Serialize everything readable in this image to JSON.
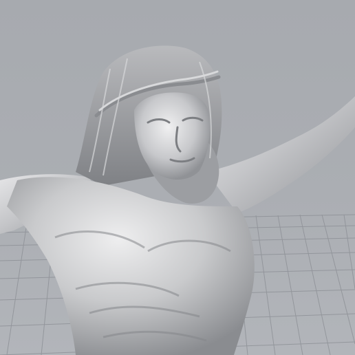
{
  "viewport": {
    "background_color": "#a9acb1",
    "grid_color": "#8e9197",
    "model_color": "#c9cacc",
    "model_shadow_color": "#7d7f83"
  },
  "scene": {
    "object": "sculpture-model",
    "ground": "perspective-grid"
  }
}
